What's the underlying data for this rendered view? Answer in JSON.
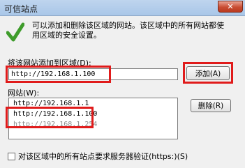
{
  "window": {
    "title": "可信站点",
    "close_glyph": "✕"
  },
  "description": {
    "line1": "可以添加和删除该区域的网站。该区域中的所有网站都使",
    "line2": "用区域的安全设置。"
  },
  "add_section": {
    "label": "将该网站添加到区域(D):",
    "input_value": "http://192.168.1.100",
    "add_button": "添加(A)"
  },
  "sites": {
    "label": "网站(W):",
    "items": [
      "http://192.168.1.1",
      "http://192.168.1.100",
      "http://192.168.1.254"
    ],
    "remove_button": "删除(R)"
  },
  "https_option": {
    "label": "对该区域中的所有站点要求服务器验证(https:)(S)"
  },
  "colors": {
    "highlight": "#e01b1b",
    "check_icon": "#3e9c2b"
  }
}
